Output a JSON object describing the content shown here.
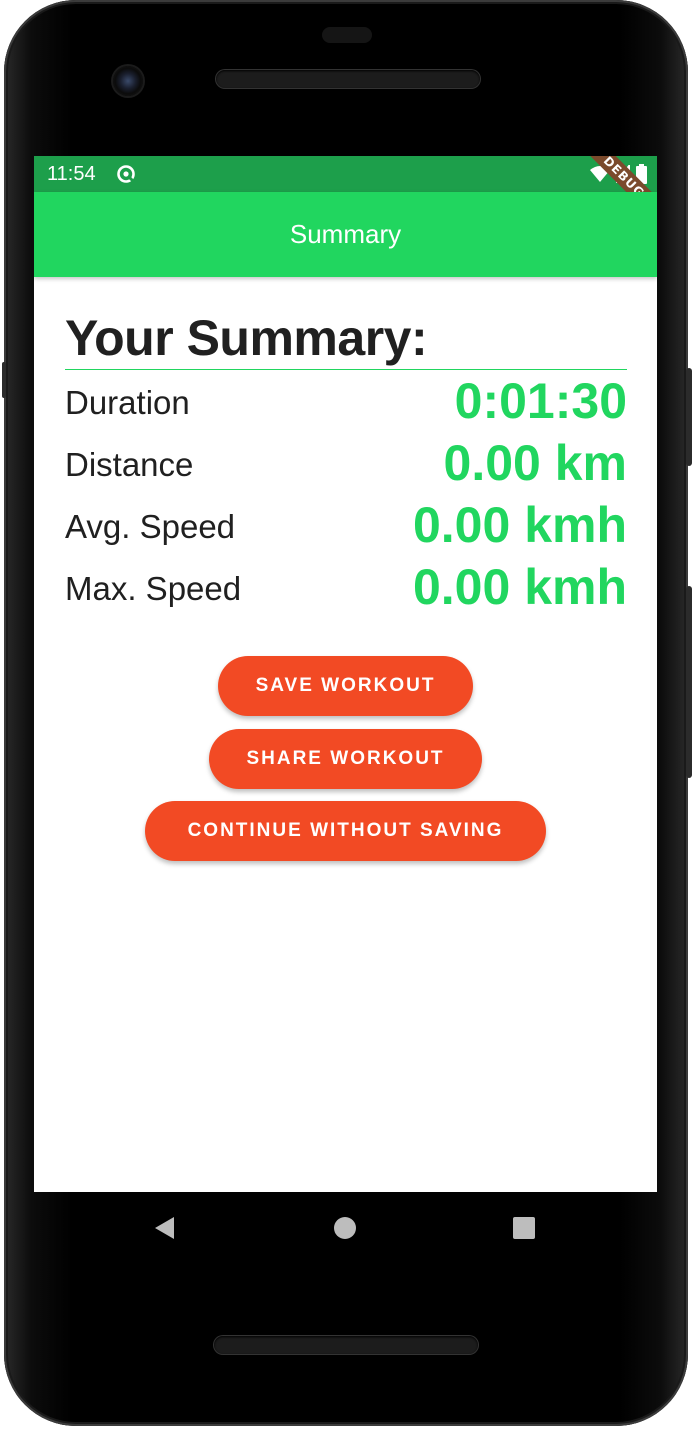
{
  "status_bar": {
    "time": "11:54",
    "debug_label": "DEBUG"
  },
  "app_bar": {
    "title": "Summary"
  },
  "summary": {
    "heading": "Your Summary:",
    "stats": [
      {
        "label": "Duration",
        "value": "0:01:30"
      },
      {
        "label": "Distance",
        "value": "0.00 km"
      },
      {
        "label": "Avg. Speed",
        "value": "0.00 kmh"
      },
      {
        "label": "Max. Speed",
        "value": "0.00 kmh"
      }
    ]
  },
  "actions": {
    "save": "SAVE WORKOUT",
    "share": "SHARE WORKOUT",
    "continue": "CONTINUE WITHOUT SAVING"
  },
  "colors": {
    "status_bar": "#1d9f4b",
    "app_bar": "#21d65f",
    "accent_value": "#21d65f",
    "button": "#f24a24",
    "text_dark": "#202020"
  },
  "icons": {
    "status_sync": "sync-icon",
    "wifi": "wifi-icon",
    "signal": "signal-icon",
    "battery": "battery-icon",
    "nav_back": "back-triangle-icon",
    "nav_home": "home-circle-icon",
    "nav_recents": "recents-square-icon"
  }
}
